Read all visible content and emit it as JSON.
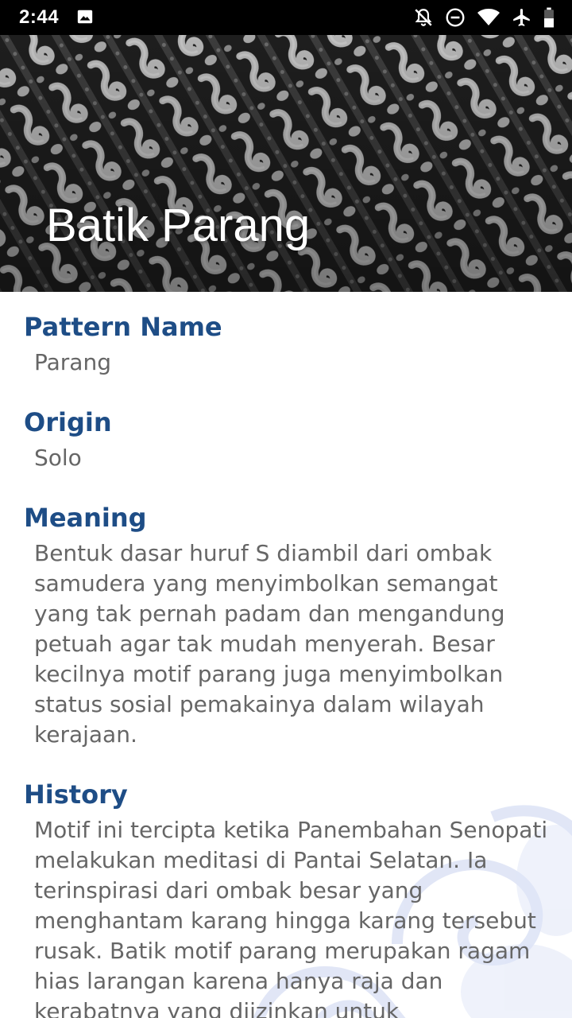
{
  "status_bar": {
    "time": "2:44",
    "icons": [
      "image-icon",
      "notifications-off-icon",
      "do-not-disturb-icon",
      "wifi-icon",
      "airplane-icon",
      "battery-icon"
    ]
  },
  "header": {
    "title": "Batik Parang",
    "image": "batik-parang-pattern"
  },
  "details": {
    "pattern_name": {
      "label": "Pattern Name",
      "value": "Parang"
    },
    "origin": {
      "label": "Origin",
      "value": "Solo"
    },
    "meaning": {
      "label": "Meaning",
      "value": "Bentuk dasar huruf S diambil dari ombak samudera yang menyimbolkan semangat yang tak pernah padam dan mengandung petuah agar tak mudah menyerah. Besar kecilnya motif parang juga menyimbolkan status sosial pemakainya dalam wilayah kerajaan."
    },
    "history": {
      "label": "History",
      "value": "Motif ini tercipta ketika Panembahan Senopati melakukan meditasi di Pantai Selatan. Ia terinspirasi dari ombak besar yang menghantam karang hingga karang tersebut rusak. Batik motif parang merupakan ragam hias larangan karena hanya raja dan kerabatnya yang diizinkan untuk"
    }
  },
  "colors": {
    "label": "#1e4d86",
    "value": "#666666",
    "status_bar": "#000000"
  }
}
